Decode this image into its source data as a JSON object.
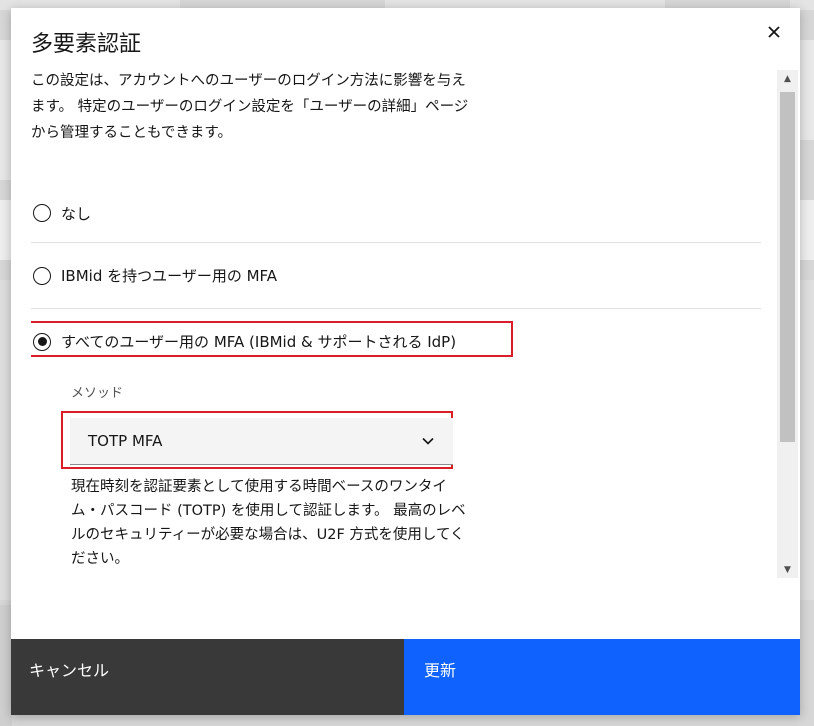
{
  "modal": {
    "title": "多要素認証",
    "close_icon": "close-icon",
    "description": "この設定は、アカウントへのユーザーのログイン方法に影響を与えます。 特定のユーザーのログイン設定を「ユーザーの詳細」ページから管理することもできます。",
    "options": [
      {
        "label": "なし",
        "selected": false
      },
      {
        "label": "IBMid を持つユーザー用の MFA",
        "selected": false
      },
      {
        "label": "すべてのユーザー用の MFA (IBMid & サポートされる IdP)",
        "selected": true
      }
    ],
    "method": {
      "label": "メソッド",
      "value": "TOTP MFA",
      "icon": "chevron-down-icon"
    },
    "help_text": "現在時刻を認証要素として使用する時間ベースのワンタイム・パスコード (TOTP) を使用して認証します。 最高のレベルのセキュリティーが必要な場合は、U2F 方式を使用してください。",
    "footer": {
      "cancel_label": "キャンセル",
      "update_label": "更新"
    }
  },
  "colors": {
    "primary": "#0f62fe",
    "secondary": "#393939",
    "highlight": "#da1e28"
  }
}
